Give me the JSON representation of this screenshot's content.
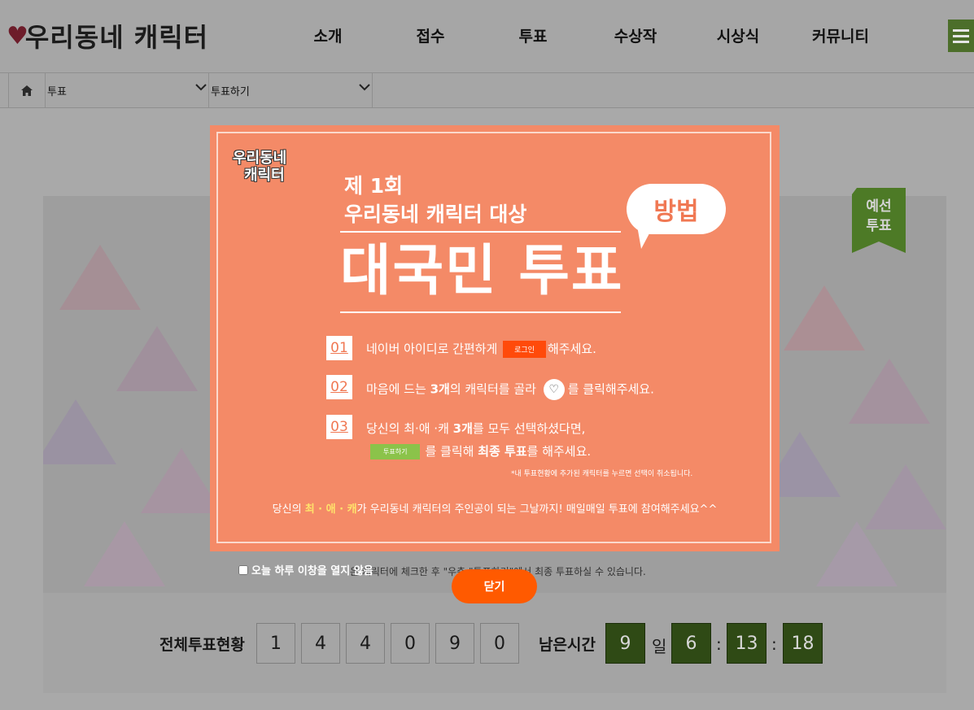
{
  "header": {
    "logo_text": "우리동네 캐릭터",
    "nav": [
      "소개",
      "접수",
      "투표",
      "수상작",
      "시상식",
      "커뮤니티"
    ]
  },
  "breadcrumb": {
    "level1": "투표",
    "level2": "투표하기"
  },
  "ribbon": {
    "label": "예선\n투표",
    "line1": "예선",
    "line2": "투표"
  },
  "status": {
    "total_label": "전체투표현황",
    "total_digits": [
      "1",
      "4",
      "4",
      "0",
      "9",
      "0"
    ],
    "remaining_label": "남은시간",
    "days": "9",
    "day_unit": "일",
    "hours": "6",
    "minutes": "13",
    "seconds": "18",
    "separator": ":"
  },
  "behind": {
    "note": "은 캐릭터에 체크한 후 \"우측 \"투표하기\"에서 최종 투표하실 수 있습니다."
  },
  "popup": {
    "logo_line1": "우리동네",
    "logo_line2": "캐릭터",
    "round": "제 1회",
    "subtitle": "우리동네 캐릭터 대상",
    "title": "대국민 투표",
    "bubble": "방법",
    "steps": [
      {
        "num": "01",
        "before": "네이버 아이디로 간편하게",
        "tag": "로그인",
        "after": "해주세요."
      },
      {
        "num": "02",
        "before": "마음에 드는",
        "bold": "3개",
        "middle": "의 캐릭터를 골라",
        "after": "를 클릭해주세요."
      },
      {
        "num": "03",
        "before": "당신의 최·애 ·캐",
        "bold": "3개",
        "after": "를 모두 선택하셨다면,",
        "line2_tag": "투표하기",
        "line2_before": "를 클릭해",
        "line2_bold": "최종 투표",
        "line2_after": "를 해주세요."
      }
    ],
    "note": "*내 투표현황에 추가된 캐릭터를 누르면 선택이 취소됩니다.",
    "bottom_before": "당신의",
    "bottom_highlight": "최 · 애 · 캐",
    "bottom_after": "가 우리동네 캐릭터의 주인공이 되는 그날까지! 매일매일 투표에 참여해주세요^^",
    "noshow_label": "오늘 하루 이창을 열지 않음",
    "close_label": "닫기"
  },
  "colors": {
    "popup_bg": "#f48a67",
    "close_btn": "#ff5a00",
    "timer_bg": "#2f4a15",
    "ribbon": "#4d7a26"
  }
}
